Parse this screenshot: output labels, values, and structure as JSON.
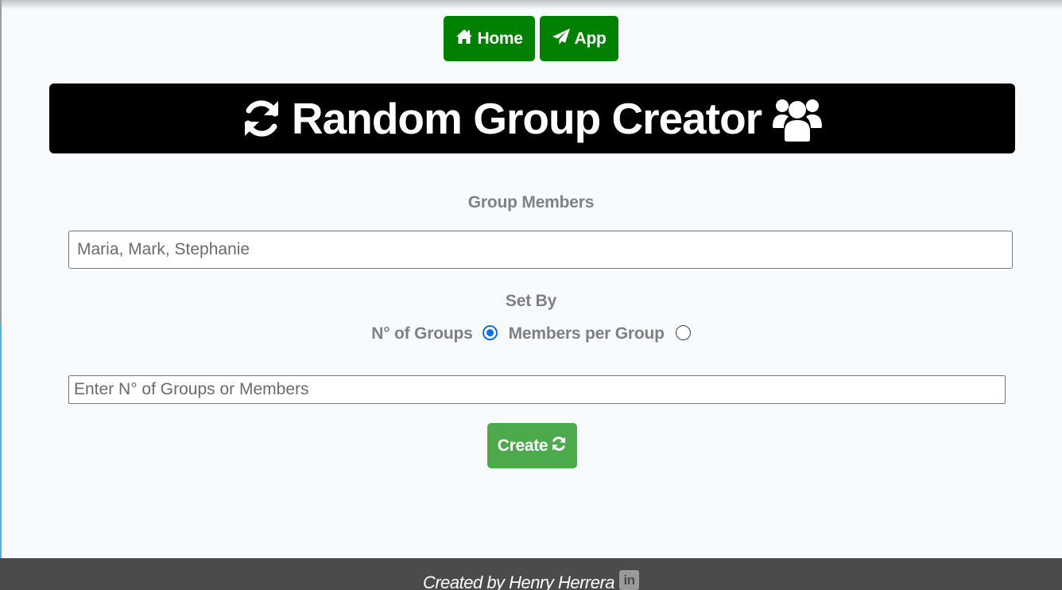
{
  "nav": {
    "home_label": "Home",
    "app_label": "App",
    "home_icon": "home-icon",
    "app_icon": "paper-plane-icon",
    "color": "#008000"
  },
  "banner": {
    "title": "Random Group Creator",
    "left_icon": "refresh-icon",
    "right_icon": "users-icon"
  },
  "form": {
    "members_label": "Group Members",
    "members_value": "Maria, Mark, Stephanie",
    "set_by_label": "Set By",
    "option_groups": "N° of Groups",
    "option_members": "Members per Group",
    "selected_option": "N° of Groups",
    "count_placeholder": "Enter N° of Groups or Members",
    "create_label": "Create",
    "create_icon": "refresh-icon",
    "create_color": "#4caa4d"
  },
  "footer": {
    "text": "Created by Henry Herrera",
    "linkedin_glyph": "in",
    "icon": "linkedin-icon"
  }
}
